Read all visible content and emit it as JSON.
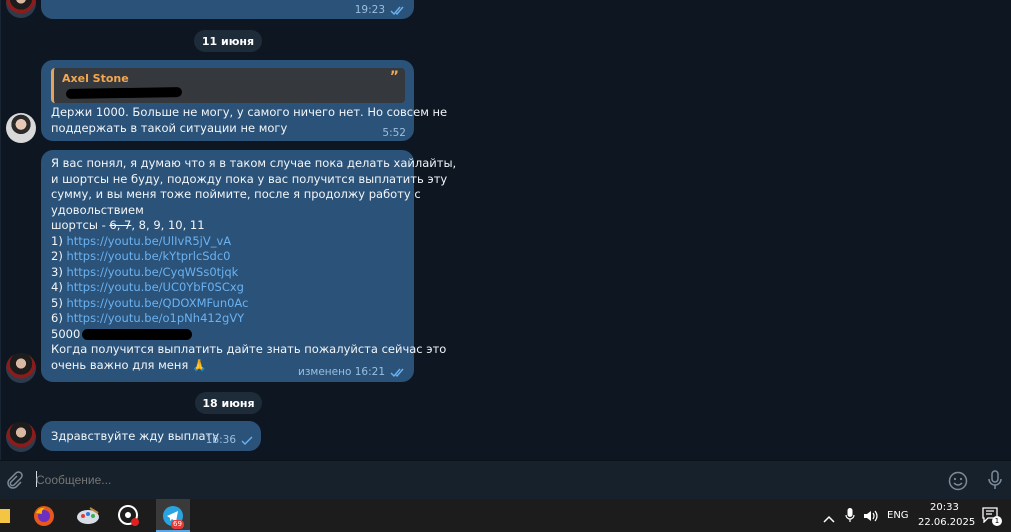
{
  "chat": {
    "top_time": "19:23",
    "date1": "11 июня",
    "msg1": {
      "reply_name": "Axel Stone",
      "lines": [
        "Держи 1000. Больше не могу, у самого ничего нет. Но совсем не",
        "поддержать в такой ситуации не могу"
      ],
      "time": "5:52"
    },
    "msg2": {
      "lines": [
        "Я вас понял, я думаю что я в таком случае пока делать хайлайты,",
        "и шортсы не буду, подожду пока у вас получится выплатить эту",
        "сумму, и вы меня тоже поймите, после я продолжу работу с",
        "удовольствием"
      ],
      "shorts_prefix": "шортсы - ",
      "shorts_struck": "6, 7",
      "shorts_rest": ", 8, 9, 10, 11",
      "links": [
        {
          "num": "1) ",
          "url": "https://youtu.be/UlIvR5jV_vA"
        },
        {
          "num": "2) ",
          "url": "https://youtu.be/kYtprlcSdc0"
        },
        {
          "num": "3) ",
          "url": "https://youtu.be/CyqWSs0tjqk"
        },
        {
          "num": "4) ",
          "url": "https://youtu.be/UC0YbF0SCxg"
        },
        {
          "num": "5) ",
          "url": "https://youtu.be/QDOXMFun0Ac"
        },
        {
          "num": "6) ",
          "url": "https://youtu.be/o1pNh412gVY"
        }
      ],
      "amount": "5000",
      "tail_lines": [
        "Когда получится выплатить дайте знать пожалуйста сейчас это",
        "очень важно для меня 🙏"
      ],
      "edited_time": "изменено 16:21"
    },
    "date2": "18 июня",
    "msg3": {
      "text": "Здравствуйте жду выплату",
      "time": "16:36"
    }
  },
  "compose": {
    "placeholder": "Сообщение..."
  },
  "taskbar": {
    "telegram_badge": "69",
    "lang": "ENG",
    "time": "20:33",
    "date": "22.06.2025",
    "notif_count": "1"
  },
  "colors": {
    "chat_bg": "#0e1621",
    "bubble": "#2b5278",
    "link": "#6ab2f2",
    "reply_accent": "#f3a74f"
  }
}
